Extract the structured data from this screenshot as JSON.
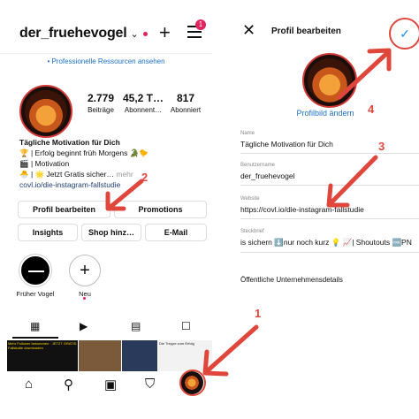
{
  "left": {
    "username": "der_fruehevogel",
    "notification_count": "1",
    "pro_banner": "• Professionelle Ressourcen ansehen",
    "stats": [
      {
        "value": "2.779",
        "label": "Beiträge"
      },
      {
        "value": "45,2 T…",
        "label": "Abonnent…"
      },
      {
        "value": "817",
        "label": "Abonniert"
      }
    ],
    "bio": {
      "title": "Tägliche Motivation für Dich",
      "line1": "🏆 | Erfolg beginnt früh Morgens 🐊🐤",
      "line2": "🎬 | Motivation",
      "line3": "🐣 | 🌟 Jetzt Gratis sicher…",
      "more": "mehr",
      "link": "covl.io/die-instagram-fallstudie"
    },
    "buttons": {
      "edit_profile": "Profil bearbeiten",
      "promotions": "Promotions",
      "insights": "Insights",
      "shop": "Shop hinz…",
      "email": "E-Mail"
    },
    "highlights": [
      {
        "label": "Früher Vogel"
      },
      {
        "label": "Neu"
      }
    ],
    "grid": [
      {
        "text": "Mehr Follower bekommen · JETZT GRATIS Fallstudie downloaden"
      },
      {
        "text": ""
      },
      {
        "text": ""
      },
      {
        "text": "Die Treppe zum Erfolg"
      }
    ]
  },
  "right": {
    "title": "Profil bearbeiten",
    "change_photo": "Profilbild ändern",
    "fields": [
      {
        "label": "Name",
        "value": "Tägliche Motivation für Dich"
      },
      {
        "label": "Benutzername",
        "value": "der_fruehevogel"
      },
      {
        "label": "Website",
        "value": "https://covl.io/die-instagram-fallstudie"
      },
      {
        "label": "Steckbrief",
        "value": "is sichern ⬇️nur noch kurz 💡 📈| Shoutouts 🆒PN"
      }
    ],
    "business_details": "Öffentliche Unternehmensdetails"
  },
  "annotations": {
    "step1": "1",
    "step2": "2",
    "step3": "3",
    "step4": "4",
    "arrow_color": "#e0473c"
  }
}
